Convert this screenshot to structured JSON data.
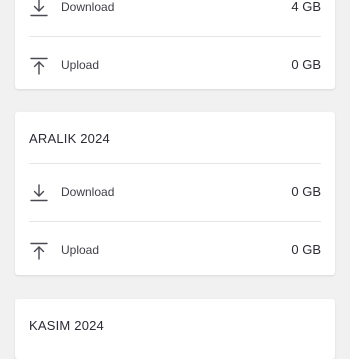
{
  "cards": [
    {
      "title": "",
      "rows": [
        {
          "icon": "download-icon",
          "label": "Download",
          "value": "4 GB"
        },
        {
          "icon": "upload-icon",
          "label": "Upload",
          "value": "0 GB"
        }
      ]
    },
    {
      "title": "ARALIK 2024",
      "rows": [
        {
          "icon": "download-icon",
          "label": "Download",
          "value": "0 GB"
        },
        {
          "icon": "upload-icon",
          "label": "Upload",
          "value": "0 GB"
        }
      ]
    },
    {
      "title": "KASIM 2024",
      "rows": []
    }
  ],
  "colors": {
    "background": "#f1f1f2",
    "card": "#ffffff",
    "text": "#2b2b33",
    "icon": "#4a4a52",
    "divider": "#e6e6e9"
  }
}
